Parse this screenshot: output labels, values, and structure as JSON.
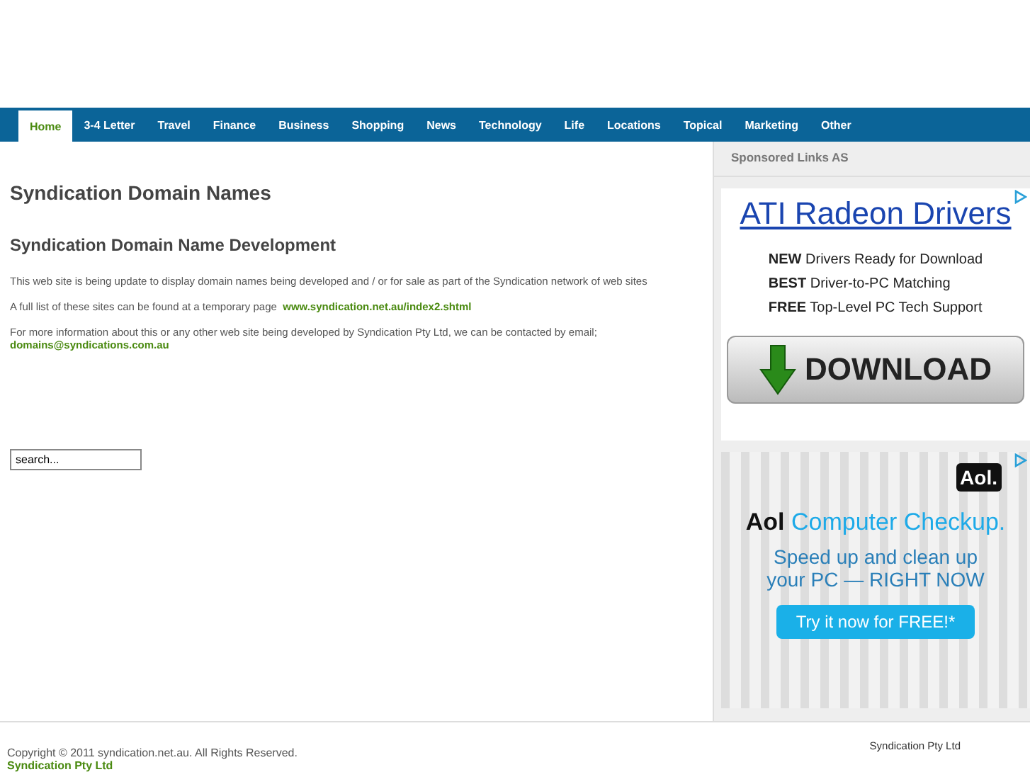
{
  "nav": [
    {
      "label": "Home",
      "selected": true
    },
    {
      "label": "3-4 Letter",
      "selected": false
    },
    {
      "label": "Travel",
      "selected": false
    },
    {
      "label": "Finance",
      "selected": false
    },
    {
      "label": "Business",
      "selected": false
    },
    {
      "label": "Shopping",
      "selected": false
    },
    {
      "label": "News",
      "selected": false
    },
    {
      "label": "Technology",
      "selected": false
    },
    {
      "label": "Life",
      "selected": false
    },
    {
      "label": "Locations",
      "selected": false
    },
    {
      "label": "Topical",
      "selected": false
    },
    {
      "label": "Marketing",
      "selected": false
    },
    {
      "label": "Other",
      "selected": false
    }
  ],
  "main": {
    "heading": "Syndication Domain Names",
    "subheading": "Syndication Domain Name Development",
    "paragraphs": [
      {
        "text": "This web site is being update to display domain names being developed and / or for sale as part of the Syndication network of web sites"
      },
      {
        "text": "A full list of these sites can be found at a temporary page",
        "link": "www.syndication.net.au/index2.shtml"
      },
      {
        "text": "For more information about this or any other web site being developed by Syndication Pty Ltd, we can be contacted by email;",
        "link": "domains@syndications.com.au"
      }
    ],
    "search": {
      "value": "search..."
    }
  },
  "sidebar": {
    "title": "Sponsored Links AS",
    "ads": [
      {
        "kind": "drivers",
        "headline": "ATI Radeon Drivers",
        "features": [
          "**NEW** Drivers Ready for Download",
          "**BEST** Driver-to-PC Matching",
          "**FREE** Top-Level PC Tech Support"
        ],
        "button": "DOWNLOAD"
      },
      {
        "kind": "checkup",
        "logo": "Aol.",
        "brand": "Aol",
        "headline": "Computer Checkup.",
        "tagline": "Speed up and clean up your PC — RIGHT NOW",
        "button": "Try it now for FREE!*"
      }
    ]
  },
  "footer": {
    "copyright": "Copyright © 2011 syndication.net.au. All Rights Reserved.",
    "link": "Syndication Pty Ltd",
    "right": "Syndication Pty Ltd"
  }
}
